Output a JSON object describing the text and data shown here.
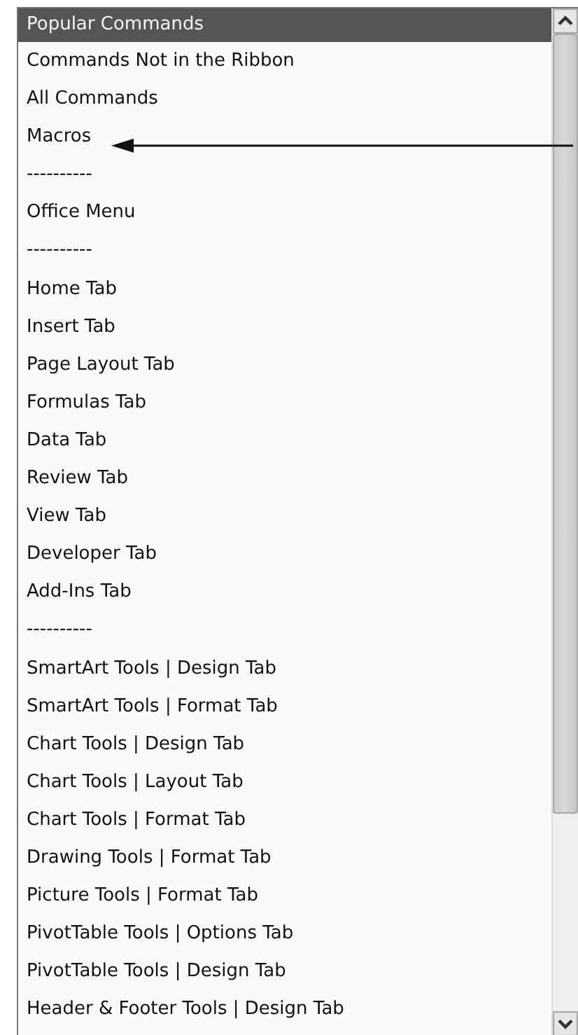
{
  "list": {
    "items": [
      {
        "label": "Popular Commands",
        "selected": true
      },
      {
        "label": "Commands Not in the Ribbon",
        "selected": false
      },
      {
        "label": "All Commands",
        "selected": false
      },
      {
        "label": "Macros",
        "selected": false
      },
      {
        "label": "----------",
        "selected": false
      },
      {
        "label": "Office Menu",
        "selected": false
      },
      {
        "label": "----------",
        "selected": false
      },
      {
        "label": "Home Tab",
        "selected": false
      },
      {
        "label": "Insert Tab",
        "selected": false
      },
      {
        "label": "Page Layout Tab",
        "selected": false
      },
      {
        "label": "Formulas Tab",
        "selected": false
      },
      {
        "label": "Data Tab",
        "selected": false
      },
      {
        "label": "Review Tab",
        "selected": false
      },
      {
        "label": "View Tab",
        "selected": false
      },
      {
        "label": "Developer Tab",
        "selected": false
      },
      {
        "label": "Add-Ins Tab",
        "selected": false
      },
      {
        "label": "----------",
        "selected": false
      },
      {
        "label": "SmartArt Tools | Design Tab",
        "selected": false
      },
      {
        "label": "SmartArt Tools | Format Tab",
        "selected": false
      },
      {
        "label": "Chart Tools | Design Tab",
        "selected": false
      },
      {
        "label": "Chart Tools | Layout Tab",
        "selected": false
      },
      {
        "label": "Chart Tools | Format Tab",
        "selected": false
      },
      {
        "label": "Drawing Tools | Format Tab",
        "selected": false
      },
      {
        "label": "Picture Tools | Format Tab",
        "selected": false
      },
      {
        "label": "PivotTable Tools | Options Tab",
        "selected": false
      },
      {
        "label": "PivotTable Tools | Design Tab",
        "selected": false
      },
      {
        "label": "Header & Footer Tools | Design Tab",
        "selected": false
      }
    ]
  }
}
